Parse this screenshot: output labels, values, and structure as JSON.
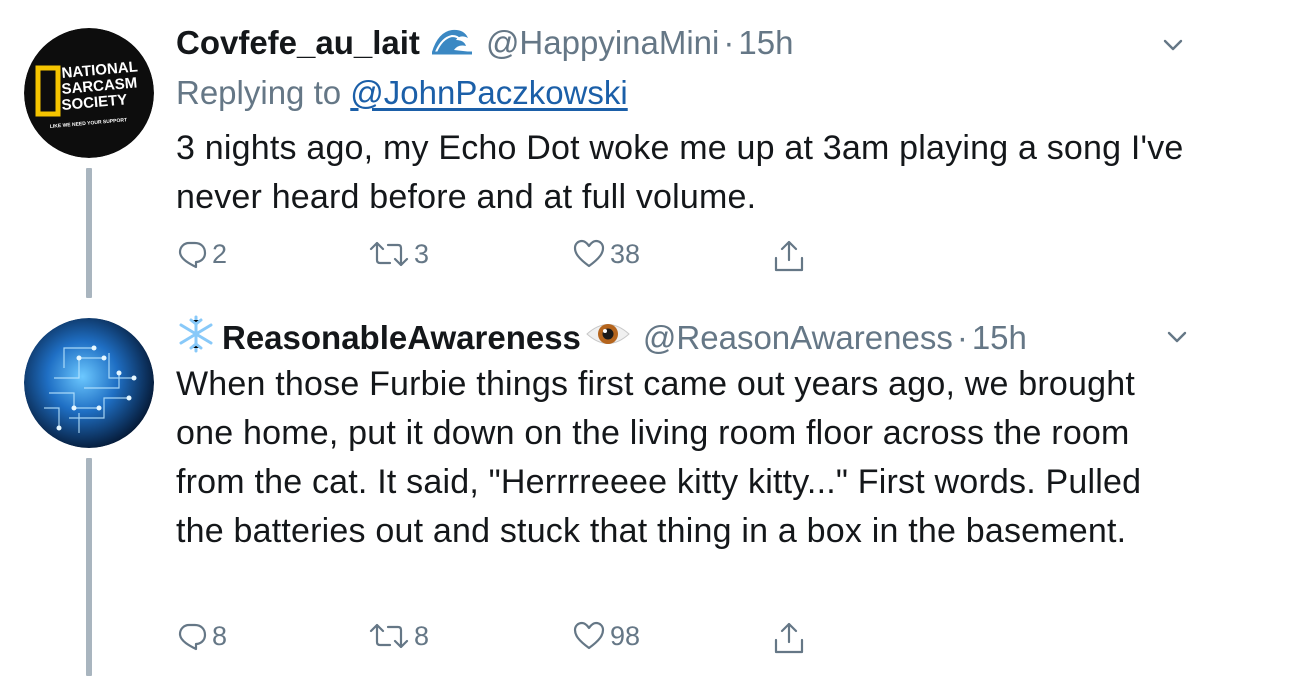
{
  "tweets": [
    {
      "display_name": "Covfefe_au_lait",
      "name_emoji": "wave-emoji",
      "handle": "@HappyinaMini",
      "separator": "·",
      "time": "15h",
      "replying_prefix": "Replying to",
      "replying_to": "@JohnPaczkowski",
      "text": "3 nights ago, my Echo Dot woke me up at 3am playing a song I've never heard before and at full volume.",
      "avatar": {
        "line1": "NATIONAL",
        "line2": "SARCASM",
        "line3": "SOCIETY",
        "tagline": "LIKE WE NEED YOUR SUPPORT"
      },
      "replies": "2",
      "retweets": "3",
      "likes": "38"
    },
    {
      "display_name": "ReasonableAwareness",
      "name_emoji_prefix": "snowflake-emoji",
      "name_emoji": "eye-emoji",
      "handle": "@ReasonAwareness",
      "separator": "·",
      "time": "15h",
      "text": "When those Furbie things first came out years ago, we brought one home, put it down on the living room floor across the room from the cat. It said, \"Herrrreeee kitty kitty...\" First words. Pulled the batteries out and stuck that thing in a box in the basement.",
      "replies": "8",
      "retweets": "8",
      "likes": "98"
    }
  ],
  "colors": {
    "text": "#14171a",
    "muted": "#657786",
    "link": "#1b5fa8",
    "thread_line": "#a9b5bf",
    "avatar1_bg": "#0d0d0d",
    "avatar1_accent": "#f5c400"
  }
}
